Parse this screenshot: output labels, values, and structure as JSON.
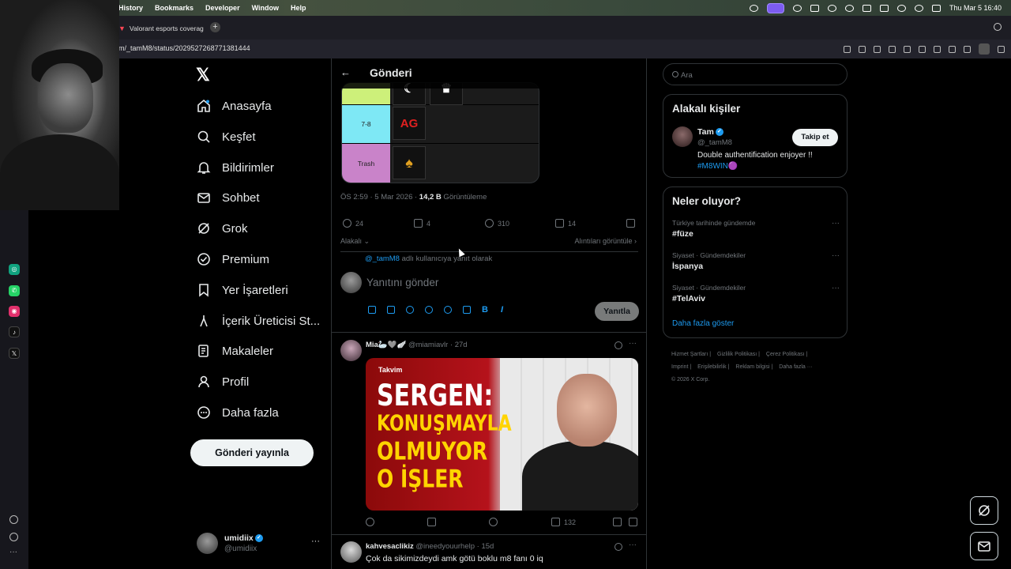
{
  "menubar": {
    "items": [
      "History",
      "Bookmarks",
      "Developer",
      "Window",
      "Help"
    ],
    "clock": "Thu Mar 5  16:40"
  },
  "browser": {
    "tab_title": "Valorant esports coverag",
    "url": "m/_tamM8/status/2029527268771381444"
  },
  "nav": {
    "items": [
      {
        "label": "Anasayfa",
        "icon": "home-icon"
      },
      {
        "label": "Keşfet",
        "icon": "search-icon"
      },
      {
        "label": "Bildirimler",
        "icon": "bell-icon"
      },
      {
        "label": "Sohbet",
        "icon": "mail-icon"
      },
      {
        "label": "Grok",
        "icon": "grok-icon"
      },
      {
        "label": "Premium",
        "icon": "verified-icon"
      },
      {
        "label": "Yer İşaretleri",
        "icon": "bookmark-icon"
      },
      {
        "label": "İçerik Üreticisi St...",
        "icon": "creator-icon"
      },
      {
        "label": "Makaleler",
        "icon": "article-icon"
      },
      {
        "label": "Profil",
        "icon": "profile-icon"
      },
      {
        "label": "Daha fazla",
        "icon": "more-icon"
      }
    ],
    "post_button": "Gönderi yayınla",
    "me": {
      "name": "umidiix",
      "handle": "@umidiix",
      "more": "···"
    }
  },
  "main": {
    "back": "←",
    "title": "Gönderi",
    "tierlist": {
      "rows": [
        {
          "label": "",
          "color": "#cdf07a",
          "logos": [
            "☾",
            "♛"
          ]
        },
        {
          "label": "7-8",
          "color": "#7ee8f5",
          "logos": [
            "AG"
          ]
        },
        {
          "label": "Trash",
          "color": "#c983c9",
          "logos": [
            "♠"
          ]
        }
      ]
    },
    "meta": {
      "time": "ÖS 2:59 · 5 Mar 2026 · ",
      "views_count": "14,2 B",
      "views_label": " Görüntüleme"
    },
    "actions": {
      "replies": "24",
      "reposts": "4",
      "likes": "310",
      "bookmarks": "14"
    },
    "relevance": "Alakalı ⌄",
    "quotes": "Alıntıları görüntüle ›",
    "reply_to_prefix": "@_tamM8",
    "reply_to_suffix": " adlı kullanıcıya yanıt olarak",
    "reply_placeholder": "Yanıtını gönder",
    "reply_button": "Yanıtla",
    "tweets": [
      {
        "name": "Mia🦢🩶🪽",
        "handle": "@miamiavlr",
        "age": "· 27d",
        "media": {
          "brand": "Takvim",
          "lines": [
            "SERGEN:",
            "KONUŞMAYLA",
            "OLMUYOR",
            "O İŞLER"
          ]
        },
        "views": "132"
      },
      {
        "name": "kahvesaclikiz",
        "handle": "@ineedyouurhelp",
        "age": "· 15d",
        "text": "Çok da sikimizdeydi amk götü boklu m8 fanı 0 iq"
      }
    ]
  },
  "right": {
    "search_placeholder": "Ara",
    "people": {
      "title": "Alakalı kişiler",
      "name": "Tam",
      "handle": "@_tamM8",
      "follow": "Takip et",
      "bio": "Double authentification enjoyer !!",
      "tag": "#M8WIN🟣"
    },
    "trends": {
      "title": "Neler oluyor?",
      "items": [
        {
          "context": "Türkiye tarihinde gündemde",
          "topic": "#füze"
        },
        {
          "context": "Siyaset · Gündemdekiler",
          "topic": "İspanya"
        },
        {
          "context": "Siyaset · Gündemdekiler",
          "topic": "#TelAviv"
        }
      ],
      "show_more": "Daha fazla göster"
    },
    "footer": [
      "Hizmet Şartları |",
      "Gizlilik Politikası |",
      "Çerez Politikası |",
      "Imprint |",
      "Erişilebilirlik |",
      "Reklam bilgisi |",
      "Daha fazla ···",
      "© 2026 X Corp."
    ]
  },
  "colors": {
    "accent": "#1d9bf0",
    "bg": "#000000",
    "border": "#2f3336"
  }
}
